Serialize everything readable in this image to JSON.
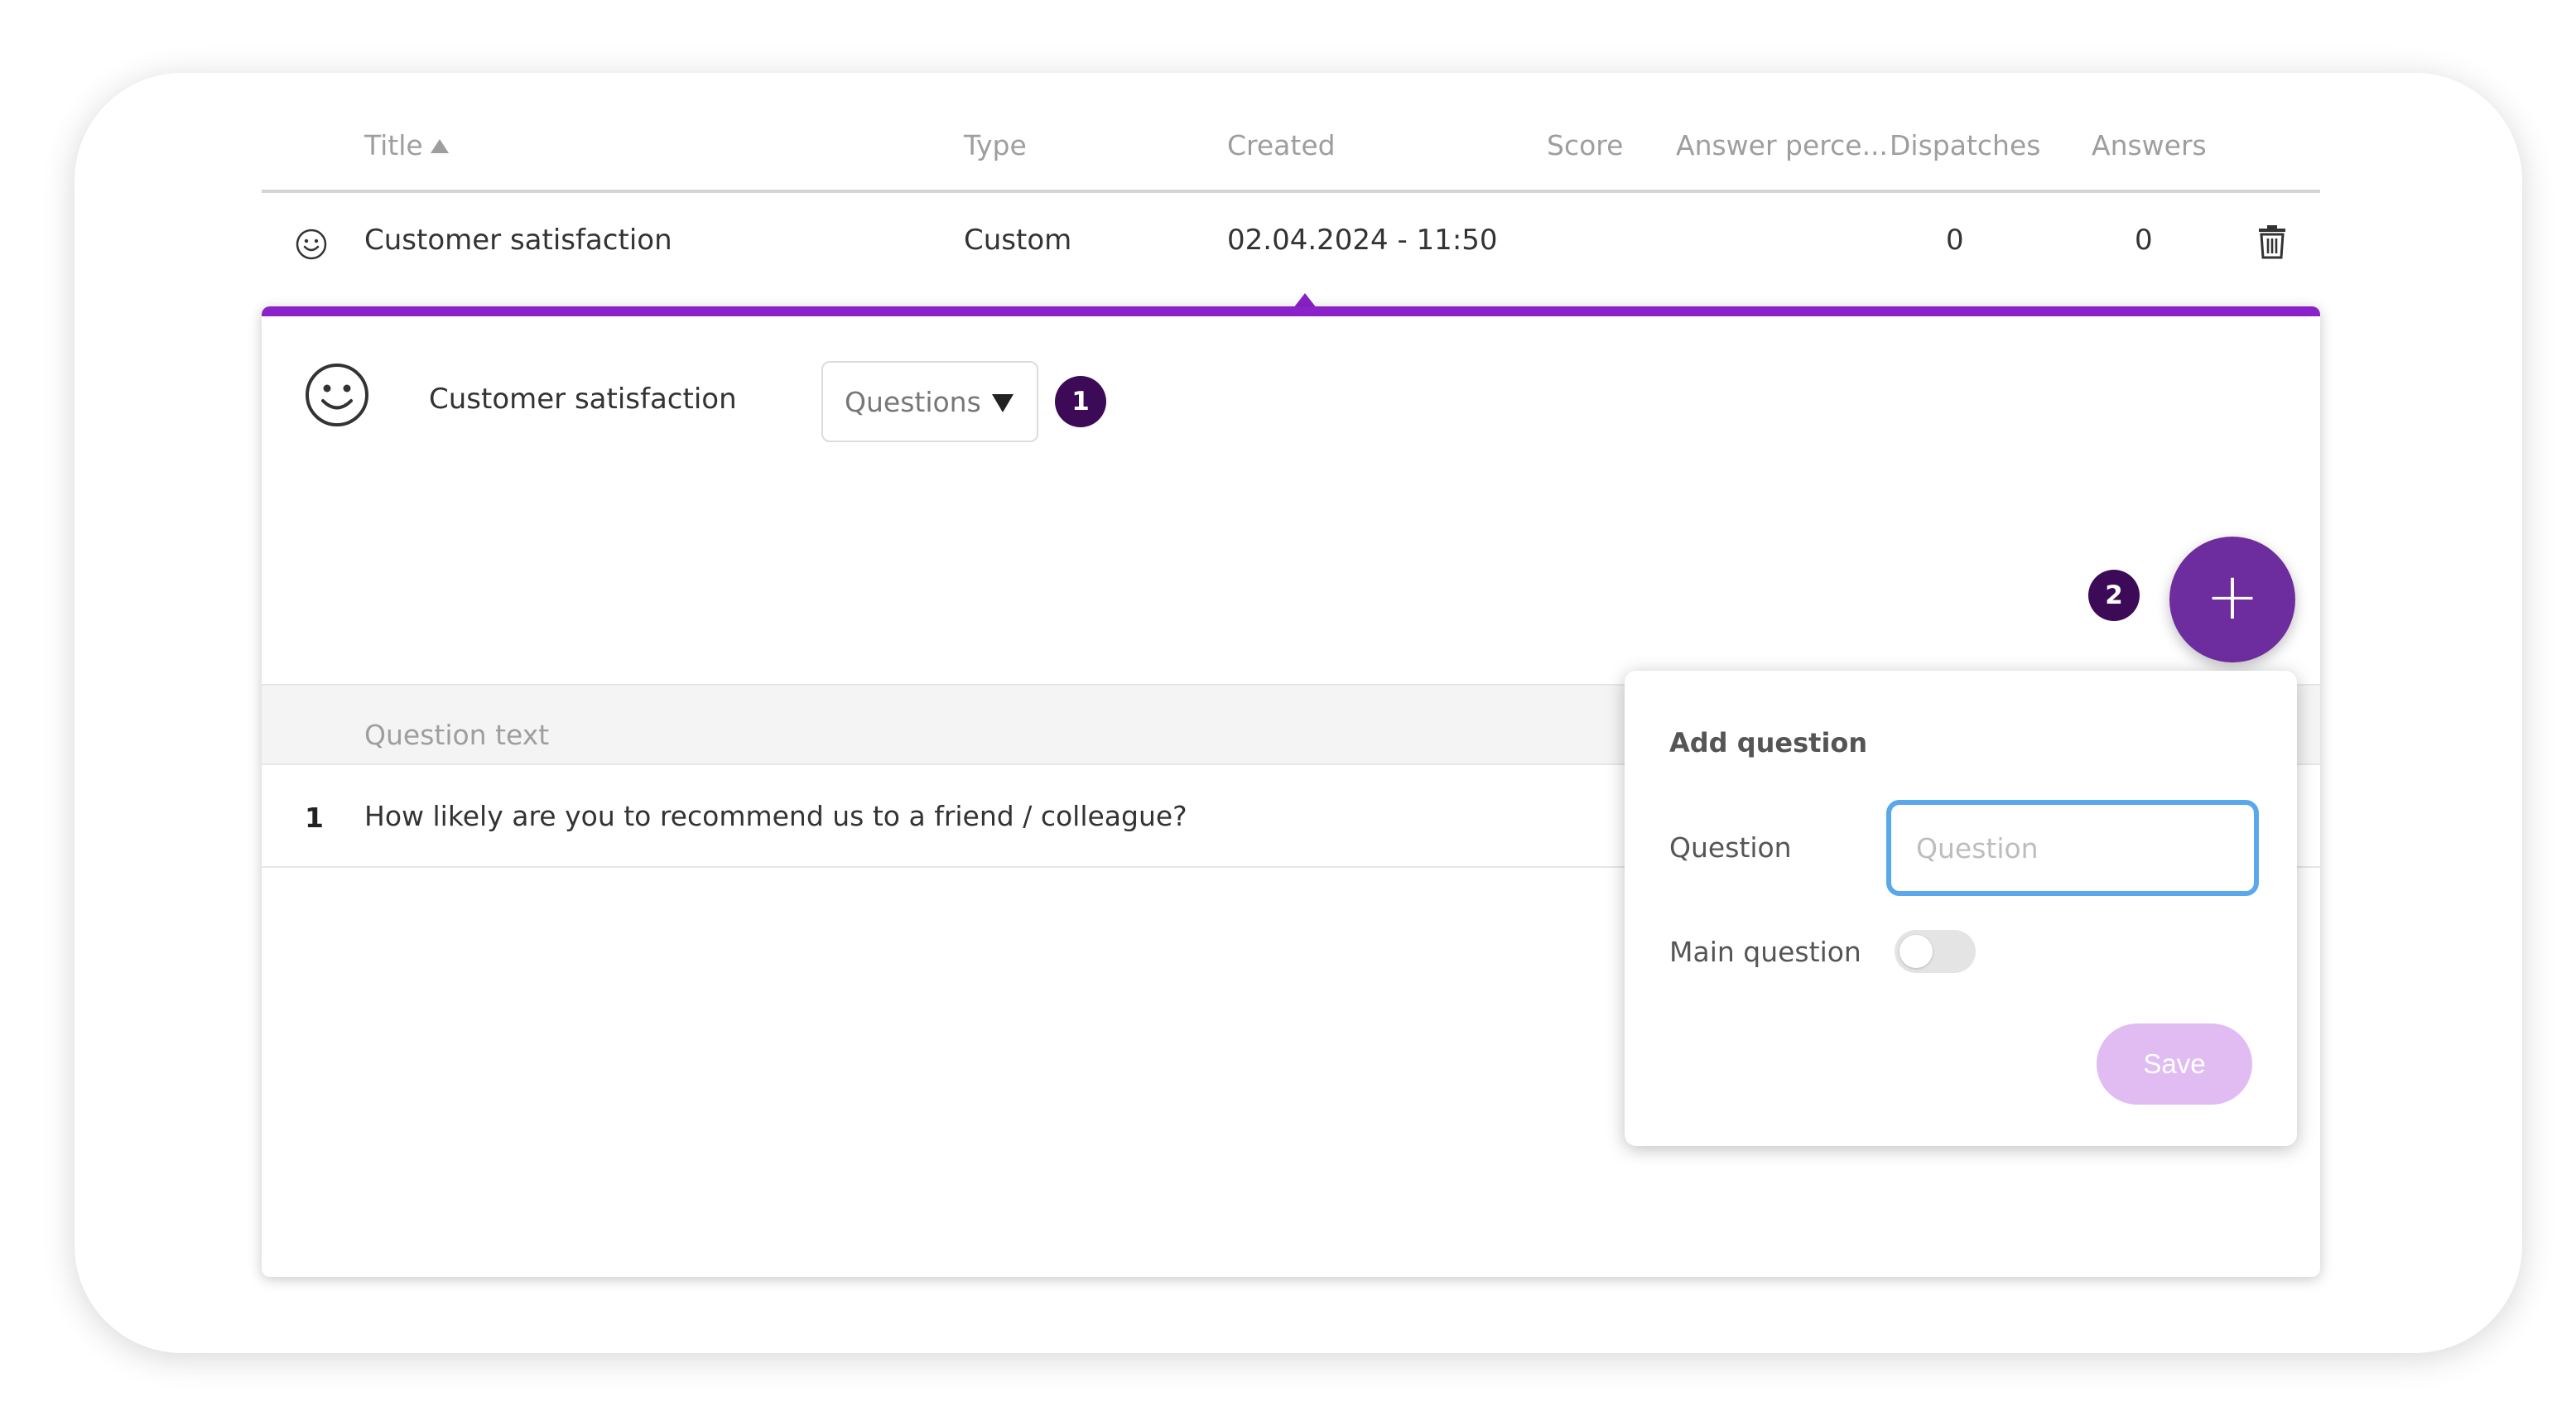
{
  "table": {
    "columns": {
      "title": "Title",
      "type": "Type",
      "created": "Created",
      "score": "Score",
      "answer_percentage": "Answer perce...",
      "dispatches": "Dispatches",
      "answers": "Answers"
    },
    "sort": {
      "column": "title",
      "direction": "ascending"
    },
    "rows": [
      {
        "icon": "smiley-icon",
        "title": "Customer satisfaction",
        "type": "Custom",
        "created": "02.04.2024 - 11:50",
        "score": "",
        "answer_percentage": "",
        "dispatches": "0",
        "answers": "0",
        "action_icon": "trash-icon"
      }
    ]
  },
  "detail": {
    "icon": "smiley-icon",
    "title": "Customer satisfaction",
    "view_select": {
      "selected": "Questions"
    },
    "step_badges": [
      "1",
      "2"
    ],
    "add_button_label": "+",
    "questions_header": "Question text",
    "questions": [
      {
        "number": "1",
        "text": "How likely are you to recommend us to a friend / colleague?"
      }
    ]
  },
  "add_question_popover": {
    "title": "Add question",
    "question_label": "Question",
    "question_placeholder": "Question",
    "question_value": "",
    "main_question_label": "Main question",
    "main_question_on": false,
    "save_label": "Save"
  },
  "colors": {
    "accent": "#8a21c9",
    "badge": "#3d0a57",
    "fab": "#6e2d9e",
    "save_disabled": "#e0bcf2",
    "input_focus": "#5aa8ec"
  }
}
